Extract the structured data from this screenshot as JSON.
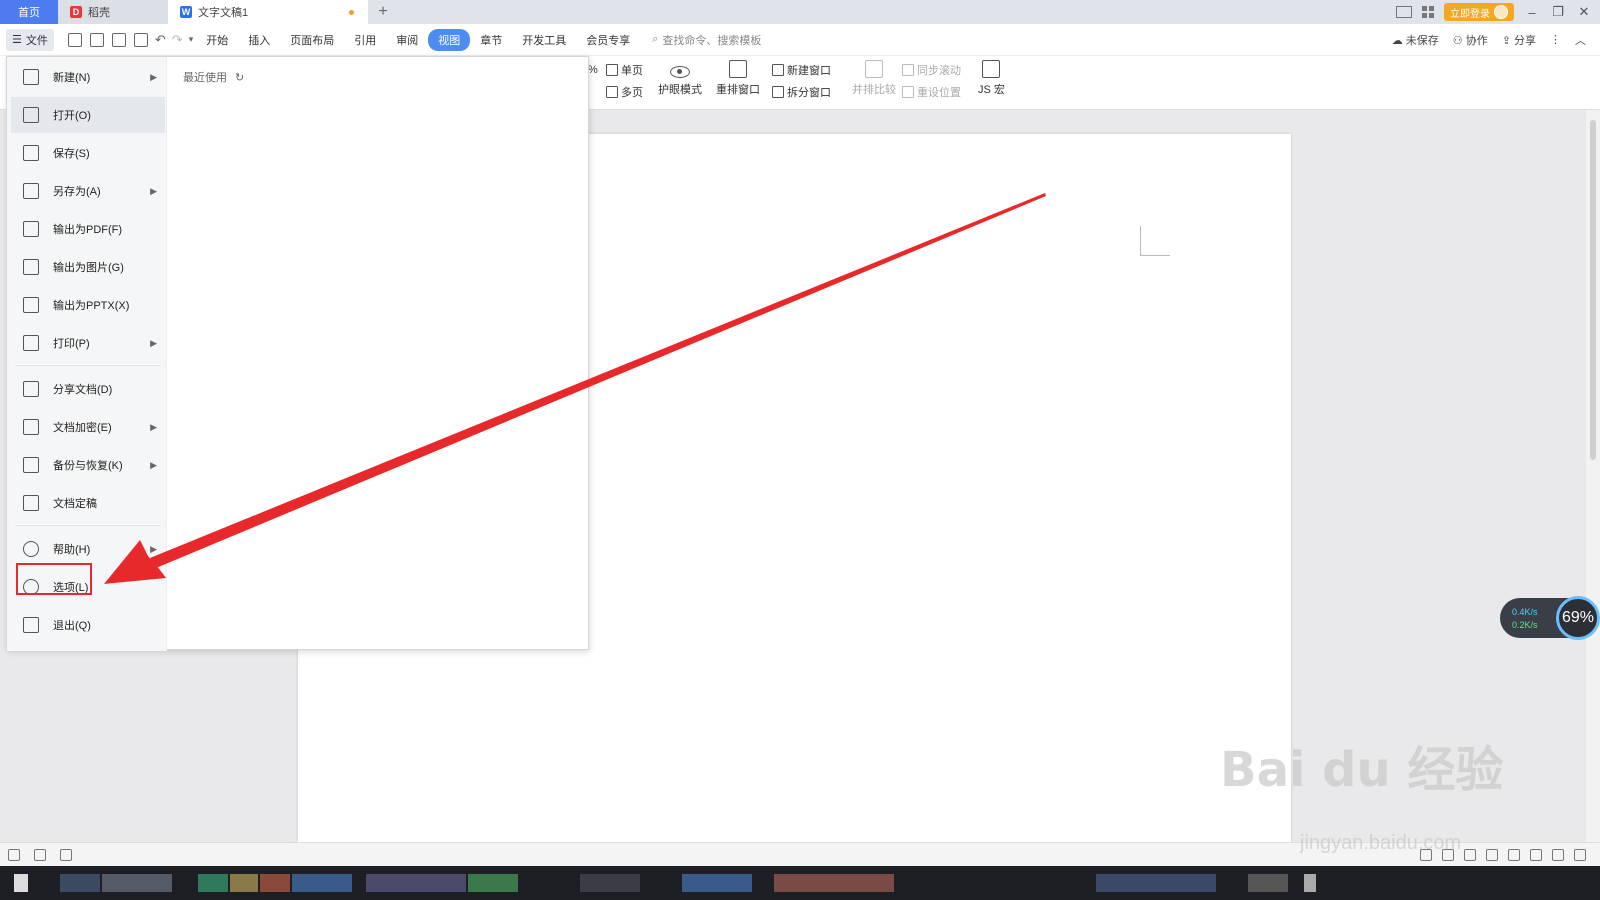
{
  "tabbar": {
    "home": "首页",
    "daoke": "稻壳",
    "doc": "文字文稿1",
    "add": "+",
    "login": "立即登录"
  },
  "menubar": {
    "file": "文件",
    "tabs": [
      "开始",
      "插入",
      "页面布局",
      "引用",
      "审阅",
      "视图",
      "章节",
      "开发工具",
      "会员专享"
    ],
    "active_tab": "视图",
    "search": "查找命令、搜索模板",
    "unsaved": "未保存",
    "collab": "协作",
    "share": "分享"
  },
  "ribbon": {
    "single_page": "单页",
    "multi_page": "多页",
    "eye_mode": "护眼模式",
    "rearrange": "重排窗口",
    "new_window": "新建窗口",
    "split_window": "拆分窗口",
    "side_by_side": "并排比较",
    "sync_scroll": "同步滚动",
    "reset_position": "重设位置",
    "js_macro": "JS 宏",
    "percent": "%"
  },
  "file_menu": {
    "recent_label": "最近使用",
    "items": [
      {
        "label": "新建(N)",
        "icon": "new-file-icon",
        "submenu": true
      },
      {
        "label": "打开(O)",
        "icon": "folder-open-icon",
        "submenu": false
      },
      {
        "label": "保存(S)",
        "icon": "save-icon",
        "submenu": false
      },
      {
        "label": "另存为(A)",
        "icon": "save-as-icon",
        "submenu": true
      },
      {
        "label": "输出为PDF(F)",
        "icon": "export-pdf-icon",
        "submenu": false
      },
      {
        "label": "输出为图片(G)",
        "icon": "export-image-icon",
        "submenu": false
      },
      {
        "label": "输出为PPTX(X)",
        "icon": "export-pptx-icon",
        "submenu": false
      },
      {
        "label": "打印(P)",
        "icon": "print-icon",
        "submenu": true
      },
      {
        "label": "分享文档(D)",
        "icon": "share-doc-icon",
        "submenu": false
      },
      {
        "label": "文档加密(E)",
        "icon": "encrypt-icon",
        "submenu": true
      },
      {
        "label": "备份与恢复(K)",
        "icon": "backup-icon",
        "submenu": true
      },
      {
        "label": "文档定稿",
        "icon": "finalize-icon",
        "submenu": false
      },
      {
        "label": "帮助(H)",
        "icon": "help-icon",
        "submenu": true
      },
      {
        "label": "选项(L)",
        "icon": "gear-icon",
        "submenu": false
      },
      {
        "label": "退出(Q)",
        "icon": "exit-icon",
        "submenu": false
      }
    ],
    "hovered": "打开(O)",
    "highlighted": "选项(L)"
  },
  "speed_widget": {
    "up": "0.4K/s",
    "down": "0.2K/s",
    "percent": "69"
  },
  "watermark": {
    "text": "Bai du 经验",
    "url": "jingyan.baidu.com"
  },
  "colors": {
    "accent": "#4d8cf0",
    "highlight": "#e8292b",
    "login": "#f5a623"
  }
}
